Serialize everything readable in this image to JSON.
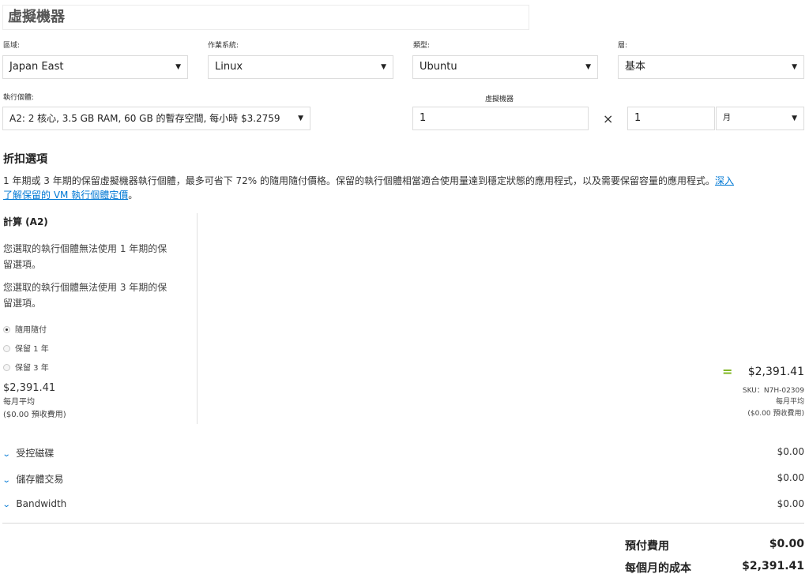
{
  "header": {
    "title": "虛擬機器"
  },
  "fields": {
    "region": {
      "label": "區域:",
      "value": "Japan East"
    },
    "os": {
      "label": "作業系統:",
      "value": "Linux"
    },
    "type": {
      "label": "類型:",
      "value": "Ubuntu"
    },
    "tier": {
      "label": "層:",
      "value": "基本"
    },
    "instance": {
      "label": "執行個體:",
      "value": "A2: 2 核心, 3.5 GB RAM, 60 GB 的暫存空間, 每小時 $3.2759"
    },
    "vm_count": {
      "label": "虛擬機器",
      "value": "1"
    },
    "times": "×",
    "duration": {
      "value": "1"
    },
    "period": {
      "value": "月"
    }
  },
  "discount": {
    "title": "折扣選項",
    "description": "1 年期或 3 年期的保留虛擬機器執行個體，最多可省下 72% 的隨用隨付價格。保留的執行個體相當適合使用量達到穩定狀態的應用程式，以及需要保留容量的應用程式。",
    "link_text_1": "深入",
    "link_text_2": "了解保留的 VM 執行個體定價",
    "end_punct": "。"
  },
  "compute": {
    "heading": "計算 (A2)",
    "note_1a": "您選取的執行個體無法使用 1 年期的保",
    "note_1b": "留選項。",
    "note_3a": "您選取的執行個體無法使用 3 年期的保",
    "note_3b": "留選項。",
    "options": [
      {
        "label": "隨用隨付",
        "selected": true
      },
      {
        "label": "保留 1 年",
        "selected": false
      },
      {
        "label": "保留 3 年",
        "selected": false
      }
    ],
    "price": "$2,391.41",
    "price_sub": "每月平均",
    "upfront": "($0.00 預收費用)"
  },
  "summary": {
    "equals": "=",
    "price": "$2,391.41",
    "sku": "SKU：N7H-02309",
    "avg": "每月平均",
    "upfront": "($0.00 預收費用)"
  },
  "accordions": [
    {
      "label": "受控磁碟",
      "value": "$0.00"
    },
    {
      "label": "儲存體交易",
      "value": "$0.00"
    },
    {
      "label": "Bandwidth",
      "value": "$0.00"
    }
  ],
  "totals": {
    "upfront_label": "預付費用",
    "upfront_value": "$0.00",
    "monthly_label": "每個月的成本",
    "monthly_value": "$2,391.41"
  },
  "colors": {
    "accent": "#0078d4",
    "equals": "#7ab317"
  }
}
